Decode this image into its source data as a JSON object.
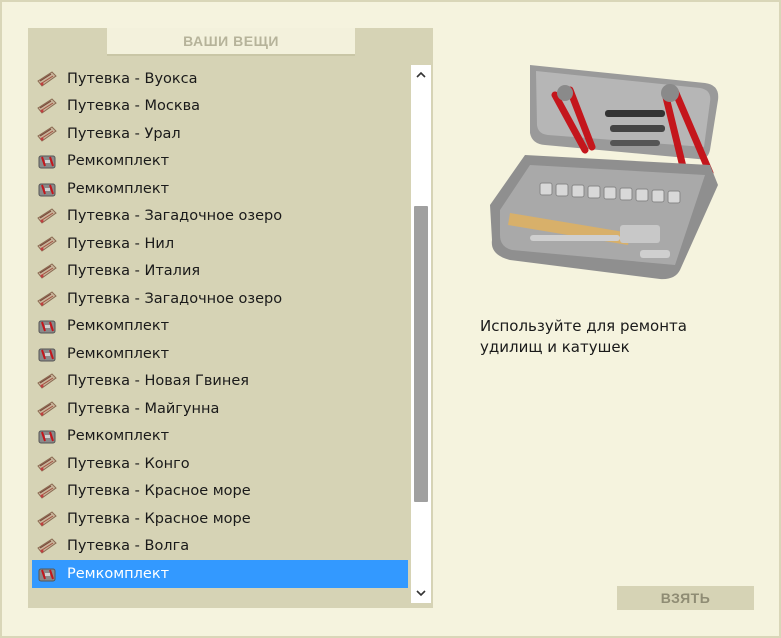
{
  "panel": {
    "title": "ВАШИ ВЕЩИ"
  },
  "items": [
    {
      "label": "Путевка - Вуокса",
      "icon": "voucher-icon"
    },
    {
      "label": "Путевка - Москва",
      "icon": "voucher-icon"
    },
    {
      "label": "Путевка - Урал",
      "icon": "voucher-icon"
    },
    {
      "label": "Ремкомплект",
      "icon": "toolkit-icon"
    },
    {
      "label": "Ремкомплект",
      "icon": "toolkit-icon"
    },
    {
      "label": "Путевка - Загадочное озеро",
      "icon": "voucher-icon"
    },
    {
      "label": "Путевка - Нил",
      "icon": "voucher-icon"
    },
    {
      "label": "Путевка - Италия",
      "icon": "voucher-icon"
    },
    {
      "label": "Путевка - Загадочное озеро",
      "icon": "voucher-icon"
    },
    {
      "label": "Ремкомплект",
      "icon": "toolkit-icon"
    },
    {
      "label": "Ремкомплект",
      "icon": "toolkit-icon"
    },
    {
      "label": "Путевка - Новая Гвинея",
      "icon": "voucher-icon"
    },
    {
      "label": "Путевка - Майгунна",
      "icon": "voucher-icon"
    },
    {
      "label": "Ремкомплект",
      "icon": "toolkit-icon"
    },
    {
      "label": "Путевка - Конго",
      "icon": "voucher-icon"
    },
    {
      "label": "Путевка - Красное море",
      "icon": "voucher-icon"
    },
    {
      "label": "Путевка - Красное море",
      "icon": "voucher-icon"
    },
    {
      "label": "Путевка - Волга",
      "icon": "voucher-icon"
    },
    {
      "label": "Ремкомплект",
      "icon": "toolkit-icon",
      "selected": true
    }
  ],
  "scrollbar": {
    "position": 0.6,
    "visible_fraction": 0.6
  },
  "detail": {
    "image": "toolkit-case-image",
    "description": "Используйте для ремонта удилищ и катушек"
  },
  "actions": {
    "take_label": "ВЗЯТЬ"
  },
  "colors": {
    "background": "#f4f2dc",
    "panel": "#d6d3b5",
    "selection": "#3399ff",
    "scroll_thumb": "#a0a0a0"
  }
}
